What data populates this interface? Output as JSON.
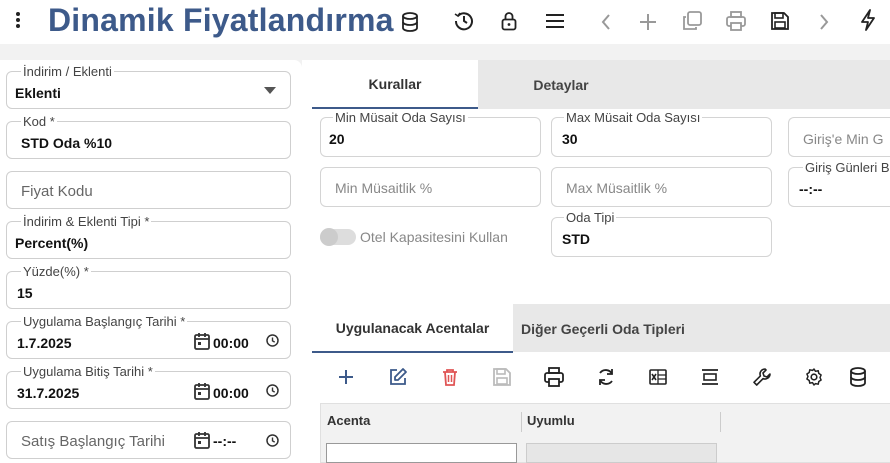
{
  "header": {
    "title": "Dinamik Fiyatlandırma"
  },
  "left_form": {
    "indirim_eklenti": {
      "label": "İndirim / Eklenti",
      "value": "Eklenti"
    },
    "kod": {
      "label": "Kod *",
      "value": "STD Oda %10"
    },
    "fiyat_kodu": {
      "placeholder": "Fiyat Kodu"
    },
    "tip": {
      "label": "İndirim & Eklenti Tipi *",
      "value": "Percent(%)"
    },
    "yuzde": {
      "label": "Yüzde(%) *",
      "value": "15"
    },
    "baslangic": {
      "label": "Uygulama Başlangıç Tarihi *",
      "date": "1.7.2025",
      "time": "00:00"
    },
    "bitis": {
      "label": "Uygulama Bitiş Tarihi *",
      "date": "31.7.2025",
      "time": "00:00"
    },
    "satis_baslangic": {
      "placeholder": "Satış Başlangıç Tarihi",
      "time": "--:--"
    }
  },
  "tabs_top": [
    {
      "label": "Kurallar",
      "active": true
    },
    {
      "label": "Detaylar",
      "active": false
    }
  ],
  "rules": {
    "min_musait_oda": {
      "label": "Min Müsait Oda Sayısı",
      "value": "20"
    },
    "max_musait_oda": {
      "label": "Max Müsait Oda Sayısı",
      "value": "30"
    },
    "giris_min": {
      "placeholder": "Giriş'e Min G"
    },
    "min_musaitlik": {
      "placeholder": "Min Müsaitlik %"
    },
    "max_musaitlik": {
      "placeholder": "Max Müsaitlik %"
    },
    "giris_gunleri": {
      "label": "Giriş Günleri B",
      "value": "--:--"
    },
    "otel_kapasite": {
      "label": "Otel Kapasitesini Kullan",
      "on": false
    },
    "oda_tipi": {
      "label": "Oda Tipi",
      "value": "STD"
    }
  },
  "tabs_bottom": [
    {
      "label": "Uygulanacak Acentalar",
      "active": true
    },
    {
      "label": "Diğer Geçerli Oda Tipleri",
      "active": false
    }
  ],
  "grid": {
    "columns": [
      "Acenta",
      "Uyumlu"
    ]
  },
  "colors": {
    "title": "#3d5a8a",
    "accent": "#3d5a8a",
    "add": "#3d5a8a",
    "edit": "#3d5a8a",
    "delete": "#e05555",
    "disabled": "#bbbbbb"
  }
}
